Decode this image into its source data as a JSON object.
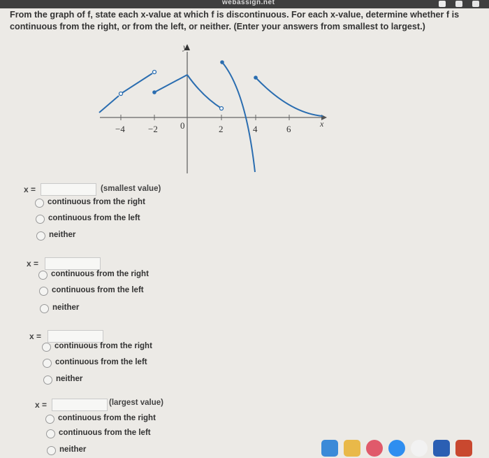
{
  "browser": {
    "site_text": "webassign.net"
  },
  "question": {
    "text": "From the graph of f, state each x-value at which f is discontinuous. For each x-value, determine whether f is continuous from the right, or from the left, or neither. (Enter your answers from smallest to largest.)"
  },
  "graph": {
    "y_axis_label": "y",
    "x_axis_label": "x",
    "x_ticks": [
      "−4",
      "−2",
      "0",
      "2",
      "4",
      "6"
    ]
  },
  "answers": [
    {
      "x_label": "x =",
      "value": "",
      "note": "(smallest value)",
      "options": [
        "continuous from the right",
        "continuous from the left",
        "neither"
      ]
    },
    {
      "x_label": "x =",
      "value": "",
      "note": "",
      "options": [
        "continuous from the right",
        "continuous from the left",
        "neither"
      ]
    },
    {
      "x_label": "x =",
      "value": "",
      "note": "",
      "options": [
        "continuous from the right",
        "continuous from the left",
        "neither"
      ]
    },
    {
      "x_label": "x =",
      "value": "",
      "note": "(largest value)",
      "options": [
        "continuous from the right",
        "continuous from the left",
        "neither"
      ]
    }
  ],
  "dock": {
    "apps": [
      "finder-icon",
      "notes-icon",
      "music-icon",
      "app-store-icon",
      "photos-icon",
      "word-icon",
      "powerpoint-icon"
    ]
  }
}
